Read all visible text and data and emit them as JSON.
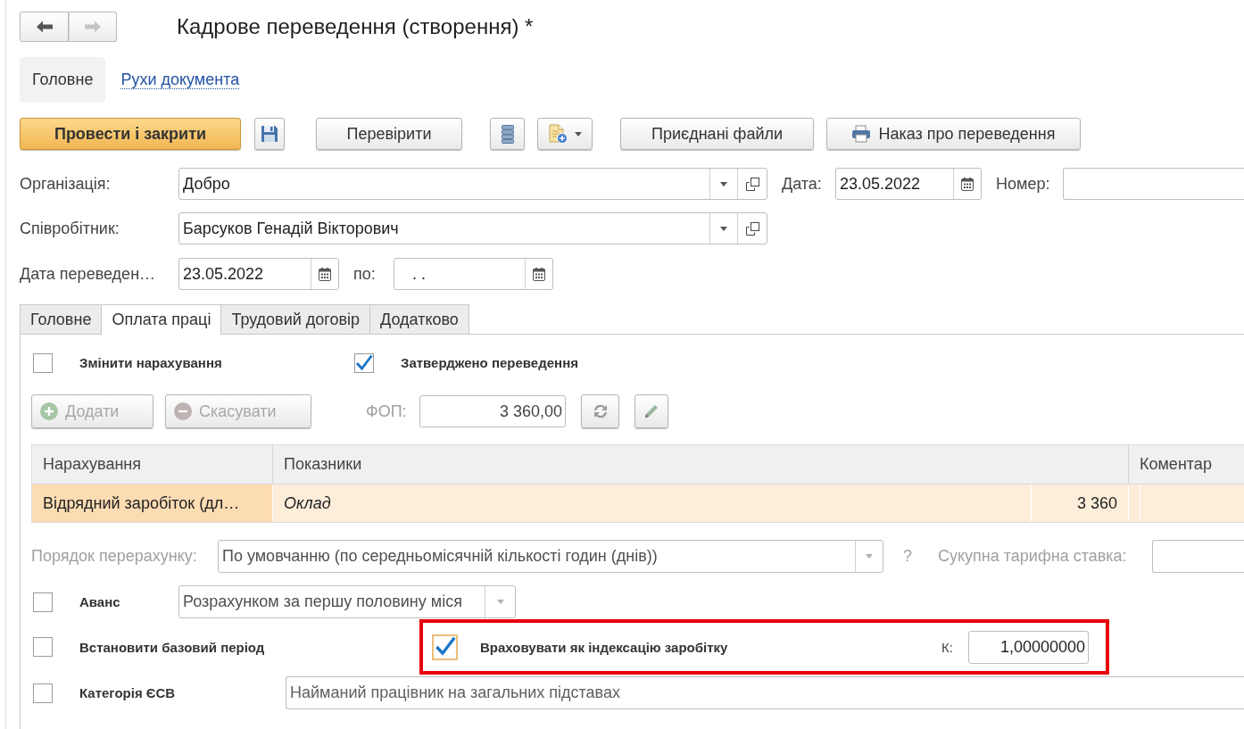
{
  "nav": [
    {
      "kind": "back",
      "disabled": false
    },
    {
      "kind": "forward",
      "disabled": true
    }
  ],
  "title": "Кадрове переведення (створення) *",
  "sections": [
    {
      "label": "Головне",
      "selected": true
    },
    {
      "label": "Рухи документа",
      "selected": false
    }
  ],
  "toolbar": {
    "post_button": "Провести і закрити",
    "check_button": "Перевірити",
    "files_button": "Приєднані файли",
    "print_button": "Наказ про переведення"
  },
  "organization": {
    "label": "Організація:",
    "value": "Добро"
  },
  "date": {
    "label": "Дата:",
    "value": "23.05.2022"
  },
  "number": {
    "label": "Номер:"
  },
  "employee": {
    "label": "Співробітник:",
    "value": "Барсуков Генадій Вікторович"
  },
  "transfer_date": {
    "label": "Дата переведен…",
    "value": "23.05.2022"
  },
  "end_date": {
    "label": "по:",
    "value": ". ."
  },
  "tabs": [
    {
      "label": "Головне",
      "selected": false
    },
    {
      "label": "Оплата праці",
      "selected": true
    },
    {
      "label": "Трудовий договір",
      "selected": false
    },
    {
      "label": "Додатково",
      "selected": false
    }
  ],
  "options": [
    {
      "label": "Змінити нарахування",
      "checked": false
    },
    {
      "label": "Затверджено переведення",
      "checked": true
    }
  ],
  "add_button": {
    "label": "Додати",
    "disabled": true
  },
  "cancel_button": {
    "label": "Скасувати",
    "disabled": true
  },
  "fund": {
    "label": "ФОП:",
    "value": "3 360,00"
  },
  "table": {
    "columns": [
      "Нарахування",
      "Показники",
      "Коментар"
    ],
    "rows": [
      {
        "accrual": "Відрядний заробіток (дл…",
        "indicator": "Оклад",
        "amount": "3 360",
        "selected": true
      }
    ]
  },
  "recalculation": {
    "label": "Порядок перерахунку:",
    "value": "По умовчанню (по середньомісячній кількості годин (днів))",
    "disabled": true,
    "help": "?"
  },
  "tariff_rate": {
    "label": "Сукупна тарифна ставка:",
    "disabled": true
  },
  "advance": {
    "label": "Аванс",
    "checked": false,
    "value": "Розрахунком за першу половину міся",
    "disabled": true
  },
  "base_period": {
    "label": "Встановити базовий період",
    "checked": false
  },
  "indexation": {
    "label": "Враховувати як індексацію заробітку",
    "checked": true,
    "focused": true,
    "highlighted": true,
    "coefficient_label": "К:",
    "coefficient": "1,00000000"
  },
  "social_tax_category": {
    "label": "Категорія ЄСВ",
    "checked": false,
    "value": "Найманий працівник на загальних підставах",
    "disabled": true
  }
}
